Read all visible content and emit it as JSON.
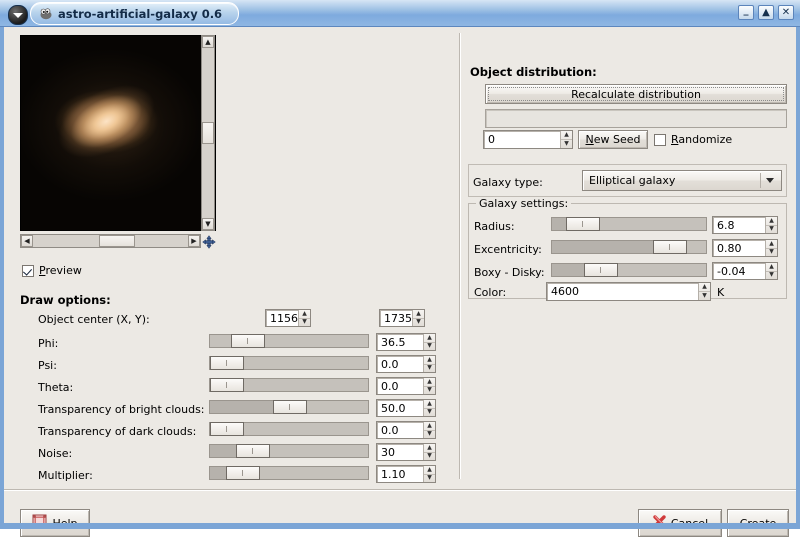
{
  "window": {
    "title": "astro-artificial-galaxy 0.6",
    "icon": "gimp-wilber-icon",
    "menu_button": "window-menu-icon",
    "buttons": {
      "minimize": "_",
      "maximize": "▲",
      "close": "×"
    }
  },
  "preview": {
    "checkbox_label": "Preview",
    "checked": true,
    "move_icon": "move-crosshair-icon",
    "scroll_up": "▲",
    "scroll_down": "▼",
    "scroll_left": "◄",
    "scroll_right": "►",
    "image_colors": {
      "core": "#ffe0b8",
      "mid": "#d2a472",
      "background": "#070503"
    }
  },
  "object_distribution": {
    "title": "Object distribution:",
    "recalculate_label": "Recalculate distribution",
    "progress_text": "",
    "seed_value": "0",
    "new_seed_label": "New Seed",
    "new_seed_mnemonic": "N",
    "randomize_label": "Randomize",
    "randomize_checked": false
  },
  "galaxy_type": {
    "label": "Galaxy type:",
    "selected": "Elliptical galaxy",
    "options": [
      "Elliptical galaxy"
    ]
  },
  "galaxy_settings": {
    "legend": "Galaxy settings:",
    "rows": [
      {
        "label": "Radius:",
        "value": "6.8",
        "slider_pct": 9,
        "unit": ""
      },
      {
        "label": "Excentricity:",
        "value": "0.80",
        "slider_pct": 72,
        "unit": ""
      },
      {
        "label": "Boxy - Disky:",
        "value": "-0.04",
        "slider_pct": 24,
        "unit": ""
      }
    ],
    "color": {
      "label": "Color:",
      "value": "4600",
      "unit": "K"
    }
  },
  "draw_options": {
    "title": "Draw options:",
    "object_center": {
      "label": "Object center (X, Y):",
      "x": "1156",
      "y": "1735"
    },
    "rows": [
      {
        "label": "Phi:",
        "value": "36.5",
        "slider_pct": 13
      },
      {
        "label": "Psi:",
        "value": "0.0",
        "slider_pct": 0
      },
      {
        "label": "Theta:",
        "value": "0.0",
        "slider_pct": 0
      },
      {
        "label": "Transparency of bright clouds:",
        "value": "50.0",
        "slider_pct": 50
      },
      {
        "label": "Transparency of dark clouds:",
        "value": "0.0",
        "slider_pct": 0
      },
      {
        "label": "Noise:",
        "value": "30",
        "slider_pct": 17
      },
      {
        "label": "Multiplier:",
        "value": "1.10",
        "slider_pct": 20
      }
    ]
  },
  "actions": {
    "help_label": "Help",
    "help_mnemonic": "H",
    "help_icon": "help-icon",
    "cancel_label": "Cancel",
    "cancel_mnemonic": "C",
    "cancel_icon": "cancel-cross-icon",
    "create_label": "Create"
  },
  "colors": {
    "titlebar": "#7eaade",
    "dialog_bg": "#ece9e4",
    "accent_cancel": "#e04b4b"
  }
}
